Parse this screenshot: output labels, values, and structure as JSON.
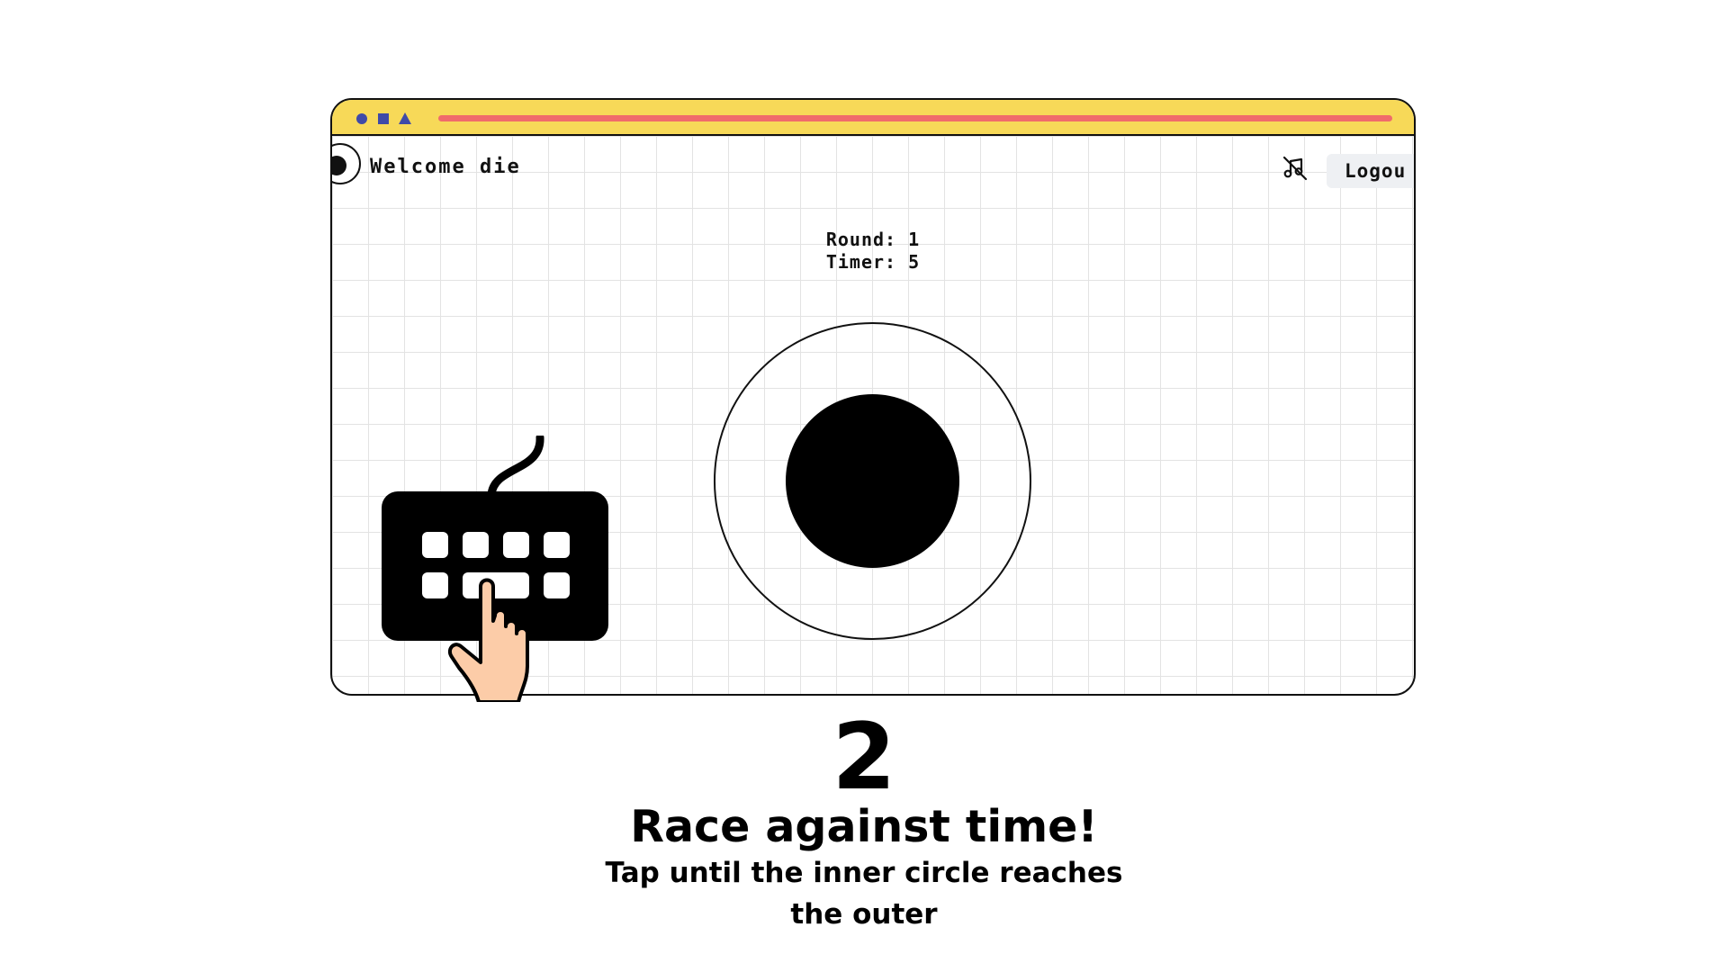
{
  "app": {
    "welcome_text": "Welcome die",
    "logout_label": "Logou"
  },
  "game": {
    "round_text": "Round: 1",
    "timer_text": "Timer: 5"
  },
  "icons": {
    "music": "music-off-icon",
    "avatar": "avatar-icon",
    "illustration": "keyboard-tap-icon"
  },
  "colors": {
    "titlebar": "#f7d958",
    "titlebar_shapes": "#3f4aa8",
    "progress_bar": "#f06b6b",
    "grid": "#e3e3e3",
    "hand": "#fccca8"
  },
  "caption": {
    "step_number": "2",
    "title": "Race against time!",
    "description": "Tap until the inner circle reaches the outer"
  }
}
